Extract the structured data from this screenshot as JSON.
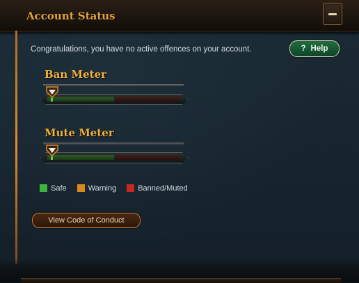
{
  "header": {
    "title": "Account Status"
  },
  "status_message": "Congratulations, you have no active offences on your account.",
  "help_button": {
    "icon": "?",
    "label": "Help"
  },
  "meters": {
    "ban": {
      "title": "Ban Meter",
      "level": 0
    },
    "mute": {
      "title": "Mute Meter",
      "level": 0
    }
  },
  "legend": [
    {
      "label": "Safe",
      "color": "#3cb53a"
    },
    {
      "label": "Warning",
      "color": "#d98a1c"
    },
    {
      "label": "Banned/Muted",
      "color": "#c42a22"
    }
  ],
  "code_of_conduct_button": {
    "label": "View Code of Conduct"
  },
  "colors": {
    "accent": "#f0b23a",
    "help_green": "#1e6d3f",
    "frame": "#e48c2e"
  }
}
